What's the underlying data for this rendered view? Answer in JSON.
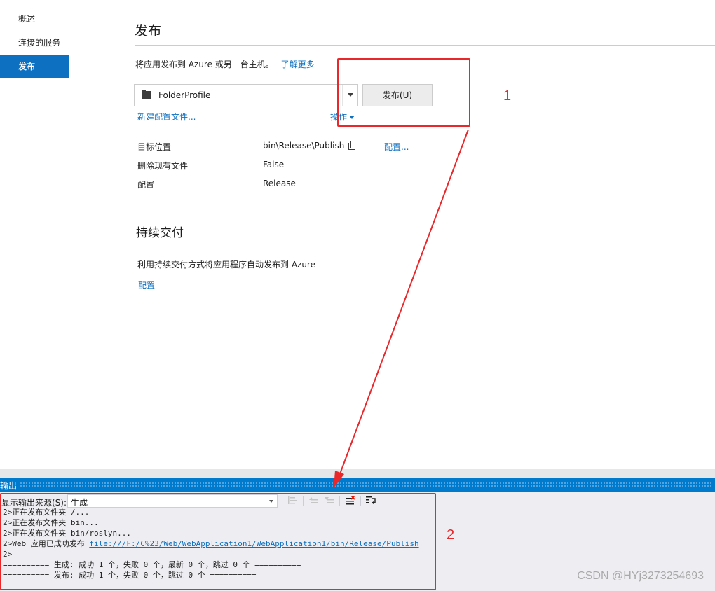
{
  "sidebar": {
    "items": [
      {
        "label": "概述"
      },
      {
        "label": "连接的服务"
      },
      {
        "label": "发布"
      }
    ],
    "active_index": 2
  },
  "publish": {
    "title": "发布",
    "description": "将应用发布到 Azure 或另一台主机。",
    "learn_more": "了解更多",
    "profile_value": "FolderProfile",
    "publish_button": "发布(U)",
    "new_profile_link": "新建配置文件...",
    "actions_link": "操作",
    "properties": [
      {
        "label": "目标位置",
        "value": "bin\\Release\\Publish"
      },
      {
        "label": "删除现有文件",
        "value": "False"
      },
      {
        "label": "配置",
        "value": "Release"
      }
    ],
    "config_link": "配置..."
  },
  "continuous_delivery": {
    "title": "持续交付",
    "description": "利用持续交付方式将应用程序自动发布到 Azure",
    "config_link": "配置"
  },
  "output": {
    "title": "输出",
    "source_label": "显示输出来源(S):",
    "source_value": "生成",
    "lines": [
      "2>正在发布文件夹 /...",
      "2>正在发布文件夹 bin...",
      "2>正在发布文件夹 bin/roslyn...",
      "2>Web 应用已成功发布 ",
      "2>",
      "========== 生成: 成功 1 个，失败 0 个，最新 0 个，跳过 0 个 ==========",
      "========== 发布: 成功 1 个，失败 0 个，跳过 0 个 =========="
    ],
    "publish_link": "file:///F:/C%23/Web/WebApplication1/WebApplication1/bin/Release/Publish"
  },
  "annotations": {
    "label_1": "1",
    "label_2": "2",
    "color": "#e8282b"
  },
  "colors": {
    "accent": "#0e70c0",
    "output_title_bar": "#007acc"
  },
  "watermark": "CSDN @HYj3273254693"
}
